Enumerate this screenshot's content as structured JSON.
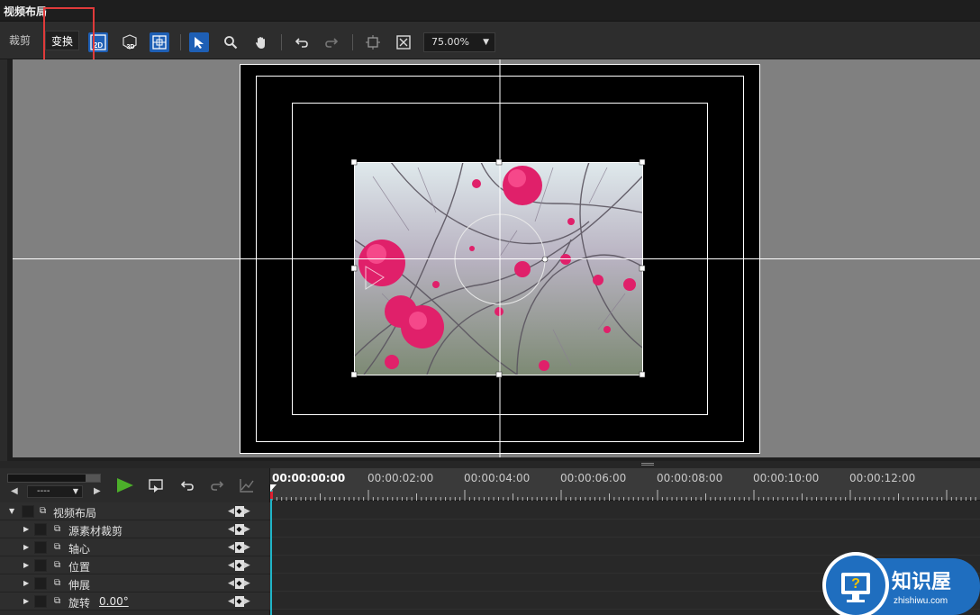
{
  "window": {
    "title": "视频布局"
  },
  "toolbar": {
    "tabs": [
      {
        "label": "裁剪"
      },
      {
        "label": "变换"
      }
    ],
    "buttons": [
      {
        "icon": "2d-icon",
        "label": "2D"
      },
      {
        "icon": "3d-icon",
        "label": "3D"
      },
      {
        "icon": "grid-icon"
      },
      {
        "icon": "select-arrow-icon"
      },
      {
        "icon": "zoom-magnifier-icon"
      },
      {
        "icon": "hand-pan-icon"
      },
      {
        "icon": "undo-icon"
      },
      {
        "icon": "redo-icon"
      },
      {
        "icon": "fit-crop-icon"
      },
      {
        "icon": "fit-window-icon"
      }
    ],
    "zoom": "75.00%"
  },
  "transport": {
    "nav_dropdown": "----"
  },
  "timeline": {
    "timecodes": [
      "00:00:00:00",
      "00:00:02:00",
      "00:00:04:00",
      "00:00:06:00",
      "00:00:08:00",
      "00:00:10:00",
      "00:00:12:00"
    ]
  },
  "tracks": [
    {
      "label": "视频布局"
    },
    {
      "label": "源素材裁剪"
    },
    {
      "label": "轴心"
    },
    {
      "label": "位置"
    },
    {
      "label": "伸展"
    },
    {
      "label": "旋转",
      "value": "0.00°"
    }
  ],
  "watermark": {
    "name": "知识屋",
    "url": "zhishiwu.com"
  },
  "colors": {
    "accent": "#1e5fb5",
    "play": "#4caf2a",
    "playhead": "#20b5c8",
    "highlight": "#e03a3a"
  }
}
